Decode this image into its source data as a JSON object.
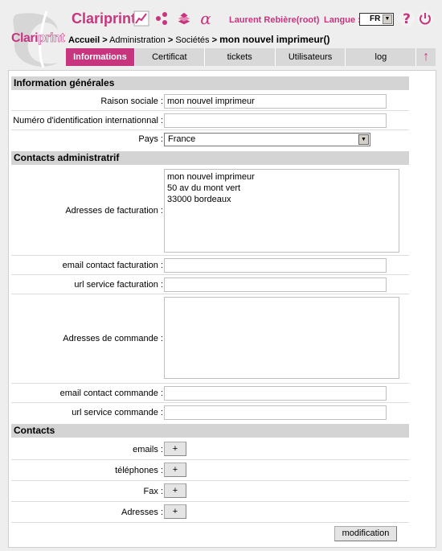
{
  "header": {
    "brand": "Clariprint",
    "logo_text_a": "Clari",
    "logo_text_b": "print",
    "user": "Laurent Rebière(root)",
    "language_label": "Langue :",
    "language_value": "FR",
    "icons": [
      "chart-icon",
      "network-icon",
      "stack-icon",
      "alpha-icon",
      "help-icon",
      "power-icon"
    ],
    "accent_color": "#c8357f"
  },
  "breadcrumb": {
    "home": "Accueil",
    "sep": ">",
    "admin": "Administration",
    "companies": "Sociétés",
    "current": "mon nouvel imprimeur()"
  },
  "tabs": [
    {
      "label": "Informations",
      "active": true
    },
    {
      "label": "Certificat",
      "active": false
    },
    {
      "label": "tickets",
      "active": false
    },
    {
      "label": "Utilisateurs",
      "active": false
    },
    {
      "label": "log",
      "active": false
    }
  ],
  "form": {
    "section_general": "Information générales",
    "raison_sociale_label": "Raison sociale :",
    "raison_sociale_value": "mon nouvel imprimeur",
    "numero_label": "Numéro d'identification internationnal :",
    "numero_value": "",
    "pays_label": "Pays :",
    "pays_value": "France",
    "section_admin": "Contacts administratrif",
    "adresses_facturation_label": "Adresses de facturation :",
    "adresses_facturation_value": "mon nouvel imprimeur\n50 av du mont vert\n33000 bordeaux",
    "email_facturation_label": "email contact facturation :",
    "email_facturation_value": "",
    "url_facturation_label": "url service facturation :",
    "url_facturation_value": "",
    "adresses_commande_label": "Adresses de commande :",
    "adresses_commande_value": "",
    "email_commande_label": "email contact commande :",
    "email_commande_value": "",
    "url_commande_label": "url service commande :",
    "url_commande_value": "",
    "section_contacts": "Contacts",
    "emails_label": "emails :",
    "telephones_label": "téléphones :",
    "fax_label": "Fax :",
    "adresses_label": "Adresses :",
    "plus_label": "+",
    "modification_label": "modification"
  }
}
